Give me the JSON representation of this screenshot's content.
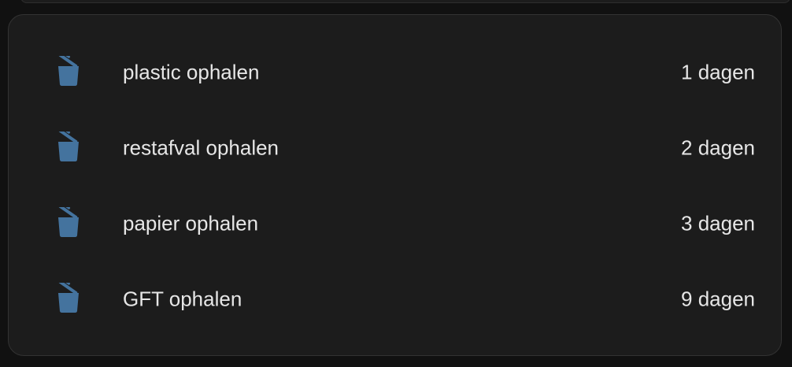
{
  "icon_color": "#44739e",
  "items": [
    {
      "icon": "trash-can-icon",
      "label": "plastic ophalen",
      "value": "1 dagen"
    },
    {
      "icon": "trash-can-icon",
      "label": "restafval ophalen",
      "value": "2 dagen"
    },
    {
      "icon": "trash-can-icon",
      "label": "papier ophalen",
      "value": "3 dagen"
    },
    {
      "icon": "trash-can-icon",
      "label": "GFT ophalen",
      "value": "9 dagen"
    }
  ]
}
